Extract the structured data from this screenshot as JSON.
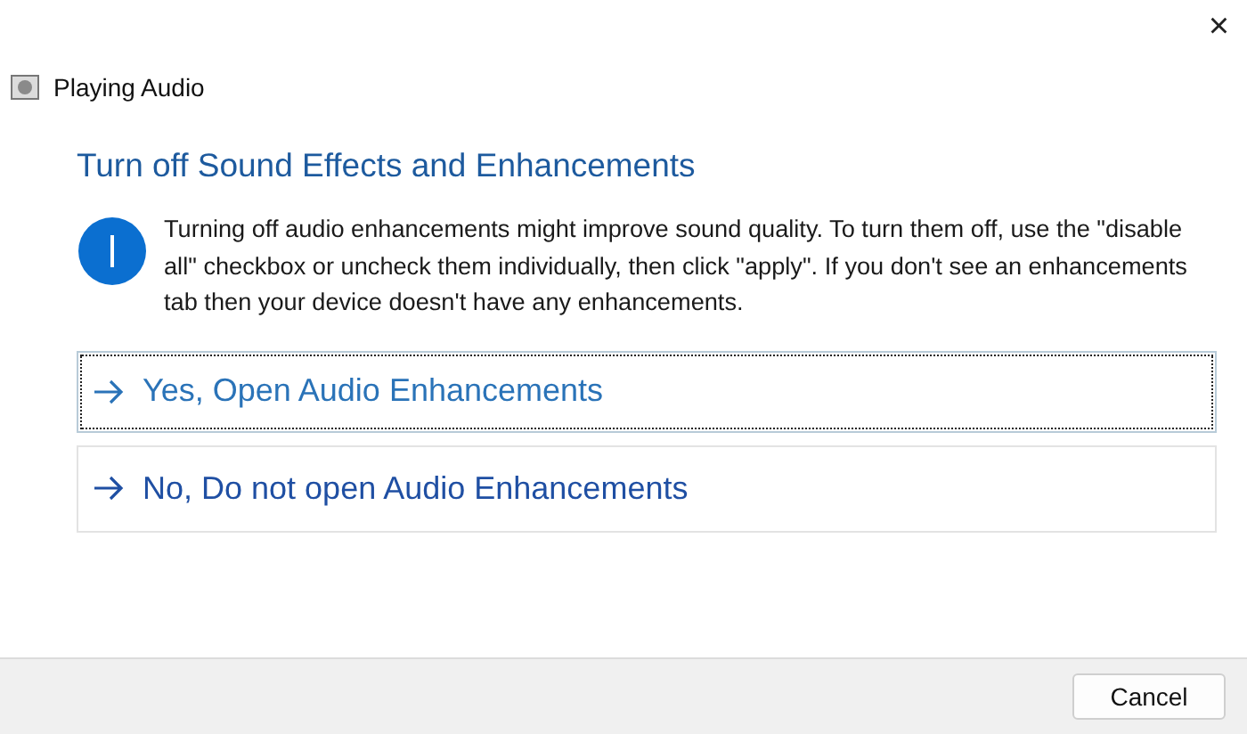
{
  "window": {
    "title": "Playing Audio",
    "close": "×"
  },
  "heading": "Turn off Sound Effects and Enhancements",
  "message": "Turning off audio enhancements might improve sound quality. To turn them off, use the \"disable all\" checkbox or uncheck them individually, then click \"apply\". If you don't see an enhancements tab then your device doesn't have any enhancements.",
  "options": [
    {
      "label": "Yes, Open Audio Enhancements",
      "focused": true
    },
    {
      "label": "No, Do not open Audio Enhancements",
      "focused": false
    }
  ],
  "buttons": [
    "Cancel"
  ]
}
